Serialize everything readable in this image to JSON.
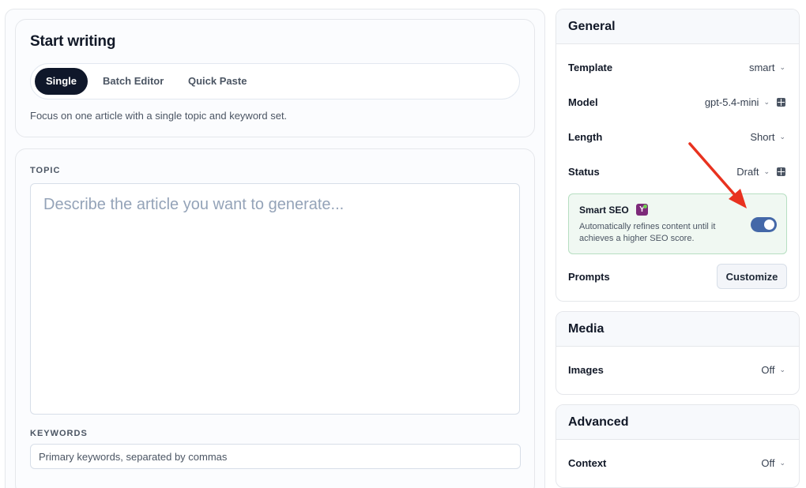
{
  "start": {
    "title": "Start writing",
    "tabs": [
      {
        "label": "Single",
        "active": true
      },
      {
        "label": "Batch Editor",
        "active": false
      },
      {
        "label": "Quick Paste",
        "active": false
      }
    ],
    "description": "Focus on one article with a single topic and keyword set."
  },
  "topic": {
    "label": "TOPIC",
    "placeholder": "Describe the article you want to generate...",
    "value": ""
  },
  "keywords": {
    "label": "KEYWORDS",
    "placeholder": "Primary keywords, separated by commas",
    "value": ""
  },
  "general": {
    "title": "General",
    "rows": [
      {
        "label": "Template",
        "value": "smart"
      },
      {
        "label": "Model",
        "value": "gpt-5.4-mini",
        "icon": "grid-settings-icon"
      },
      {
        "label": "Length",
        "value": "Short"
      },
      {
        "label": "Status",
        "value": "Draft",
        "icon": "grid-settings-icon"
      }
    ],
    "smart_seo": {
      "title": "Smart SEO",
      "badge": "Y",
      "badge_icon": "yoast-icon",
      "description": "Automatically refines content until it achieves a higher SEO score.",
      "enabled": true
    },
    "prompts_label": "Prompts",
    "customize_label": "Customize"
  },
  "media": {
    "title": "Media",
    "rows": [
      {
        "label": "Images",
        "value": "Off"
      }
    ]
  },
  "advanced": {
    "title": "Advanced",
    "rows": [
      {
        "label": "Context",
        "value": "Off"
      }
    ]
  },
  "annotation": {
    "arrow_color": "#e8321f"
  },
  "colors": {
    "toggle_on": "#4468a8",
    "active_tab": "#0f172a",
    "seo_box": "#f0f8f2"
  }
}
